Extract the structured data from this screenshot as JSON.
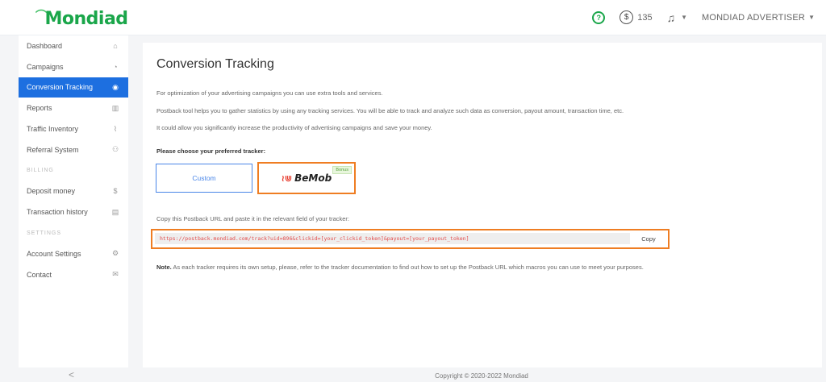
{
  "header": {
    "logo": "Mondiad",
    "balance": "135",
    "user": "MONDIAD ADVERTISER"
  },
  "sidebar": {
    "items": [
      {
        "label": "Dashboard",
        "icon": "home-icon",
        "glyph": "⌂"
      },
      {
        "label": "Campaigns",
        "icon": "pie-chart-icon",
        "glyph": "◔"
      },
      {
        "label": "Conversion Tracking",
        "icon": "globe-icon",
        "glyph": "◉"
      },
      {
        "label": "Reports",
        "icon": "bar-chart-icon",
        "glyph": "▥"
      },
      {
        "label": "Traffic Inventory",
        "icon": "line-chart-icon",
        "glyph": "⌇"
      },
      {
        "label": "Referral System",
        "icon": "users-icon",
        "glyph": "⚇"
      }
    ],
    "section_billing": "BILLING",
    "billing_items": [
      {
        "label": "Deposit money",
        "icon": "dollar-icon",
        "glyph": "$"
      },
      {
        "label": "Transaction history",
        "icon": "receipt-icon",
        "glyph": "▤"
      }
    ],
    "section_settings": "SETTINGS",
    "settings_items": [
      {
        "label": "Account Settings",
        "icon": "gears-icon",
        "glyph": "⚙"
      },
      {
        "label": "Contact",
        "icon": "envelope-icon",
        "glyph": "✉"
      }
    ]
  },
  "main": {
    "title": "Conversion Tracking",
    "para1": "For optimization of your advertising campaigns you can use extra tools and services.",
    "para2": "Postback tool helps you to gather statistics by using any tracking services. You will be able to track and analyze such data as conversion, payout amount, transaction time, etc.",
    "para3": "It could allow you significantly increase the productivity of advertising campaigns and save your money.",
    "choose_label": "Please choose your preferred tracker:",
    "tracker_custom": "Custom",
    "tracker_bemob": "BeMob",
    "bonus_badge": "Bonus",
    "copy_label": "Copy this Postback URL and paste it in the relevant field of your tracker:",
    "postback_url": "https://postback.mondiad.com/track?uid=896&clickid=[your_clickid_token]&payout=[your_payout_token]",
    "copy_button": "Copy",
    "note_bold": "Note.",
    "note_text": " As each tracker requires its own setup, please, refer to the tracker documentation to find out how to set up the Postback URL which macros you can use to meet your purposes."
  },
  "footer": {
    "copyright": "Copyright © 2020-2022 Mondiad",
    "collapse": "<"
  },
  "colors": {
    "brand": "#1aa64a",
    "active_nav": "#1d6fe0",
    "highlight": "#ef7d22",
    "url_text": "#e24b4b"
  }
}
